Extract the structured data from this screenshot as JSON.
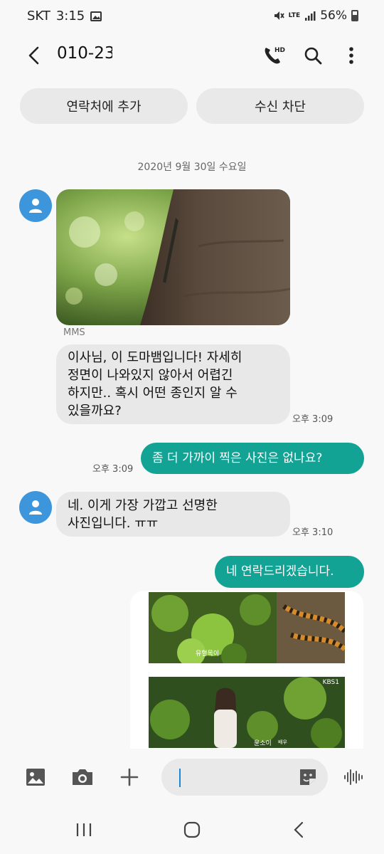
{
  "status_bar": {
    "carrier": "SKT",
    "time": "3:15",
    "network": "LTE",
    "battery": "56%"
  },
  "header": {
    "contact_number": "010-23"
  },
  "actions": {
    "add_contact": "연락처에 추가",
    "block": "수신 차단"
  },
  "conversation": {
    "date": "2020년 9월 30일 수요일",
    "mms_label": "MMS",
    "messages": [
      {
        "lines": [
          "이사님, 이 도마뱀입니다! 자세히",
          "정면이 나와있지 않아서 어렵긴",
          "하지만.. 혹시 어떤 종인지 알 수",
          "있을까요?"
        ],
        "time": "오후 3:09"
      },
      {
        "text": "좀 더 가까이 찍은 사진은  없나요?",
        "time": "오후 3:09"
      },
      {
        "lines": [
          "네. 이게 가장 가깝고 선명한",
          "사진입니다. ㅠㅠ"
        ],
        "time": "오후 3:10"
      },
      {
        "text": "네 연락드리겠습니다."
      }
    ],
    "photo_captions": {
      "first": "유혈목이",
      "second_name": "윤소이",
      "second_role": "배우",
      "broadcaster": "KBS1"
    }
  },
  "icons": {
    "back": "back-arrow-icon",
    "call": "hd-call-icon",
    "search": "search-icon",
    "more": "more-vert-icon",
    "gallery": "gallery-icon",
    "camera": "camera-icon",
    "add": "plus-icon",
    "sticker": "sticker-icon",
    "voice": "voice-wave-icon"
  },
  "colors": {
    "accent": "#12a394",
    "avatar": "#3d95db",
    "incoming_bubble": "#e8e8e8",
    "pill": "#e9e9e9"
  }
}
